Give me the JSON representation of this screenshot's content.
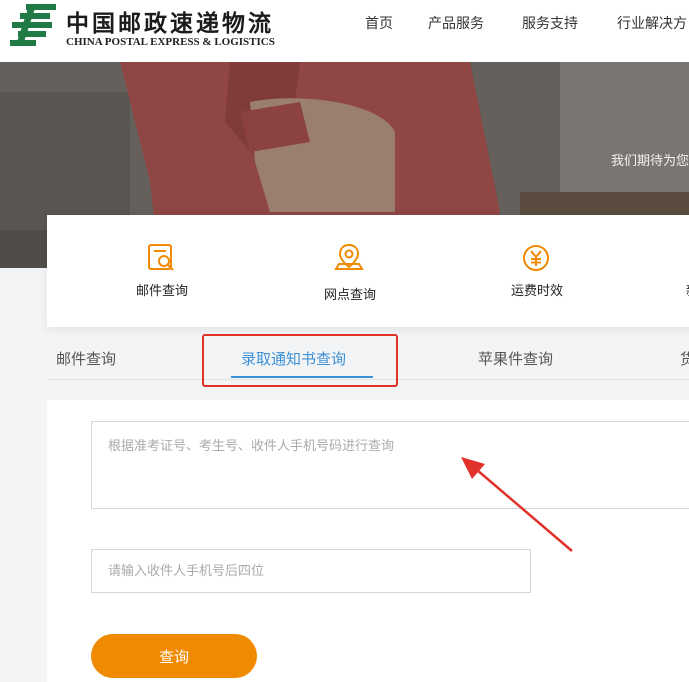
{
  "header": {
    "brand_cn": "中国邮政速递物流",
    "brand_en": "CHINA POSTAL EXPRESS & LOGISTICS",
    "logo_icon": "china-post-logo",
    "nav": [
      "首页",
      "产品服务",
      "服务支持",
      "行业解决方"
    ]
  },
  "banner": {
    "text": "我们期待为您"
  },
  "quick_services": [
    {
      "label": "邮件查询",
      "icon": "mail-search-icon"
    },
    {
      "label": "网点查询",
      "icon": "location-pin-icon"
    },
    {
      "label": "运费时效",
      "icon": "yuan-coin-icon"
    },
    {
      "label": "新",
      "icon": "partial-icon"
    }
  ],
  "tabs": {
    "items": [
      "邮件查询",
      "录取通知书查询",
      "苹果件查询",
      "货"
    ],
    "active_index": 1
  },
  "form": {
    "query_placeholder": "根据准考证号、考生号、收件人手机号码进行查询",
    "phone_placeholder": "请输入收件人手机号后四位",
    "submit_label": "查询"
  },
  "colors": {
    "accent_blue": "#3d90d6",
    "button_orange": "#f08a00",
    "brand_green": "#1f7a45",
    "annotation_red": "#e0312b"
  }
}
